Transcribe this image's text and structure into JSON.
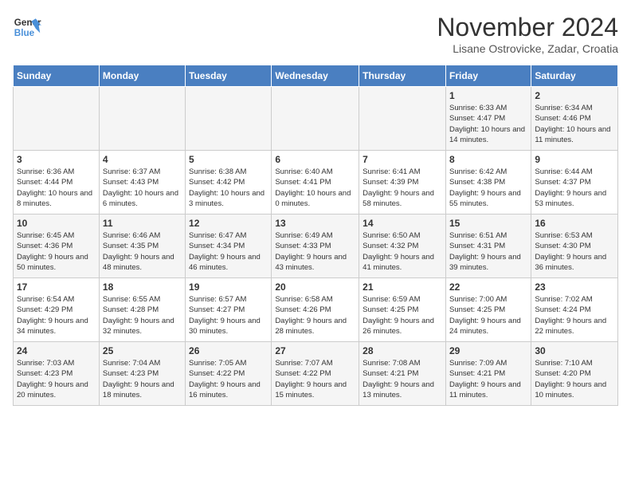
{
  "logo": {
    "line1": "General",
    "line2": "Blue"
  },
  "title": "November 2024",
  "subtitle": "Lisane Ostrovicke, Zadar, Croatia",
  "days_of_week": [
    "Sunday",
    "Monday",
    "Tuesday",
    "Wednesday",
    "Thursday",
    "Friday",
    "Saturday"
  ],
  "weeks": [
    [
      {
        "day": "",
        "info": ""
      },
      {
        "day": "",
        "info": ""
      },
      {
        "day": "",
        "info": ""
      },
      {
        "day": "",
        "info": ""
      },
      {
        "day": "",
        "info": ""
      },
      {
        "day": "1",
        "info": "Sunrise: 6:33 AM\nSunset: 4:47 PM\nDaylight: 10 hours and 14 minutes."
      },
      {
        "day": "2",
        "info": "Sunrise: 6:34 AM\nSunset: 4:46 PM\nDaylight: 10 hours and 11 minutes."
      }
    ],
    [
      {
        "day": "3",
        "info": "Sunrise: 6:36 AM\nSunset: 4:44 PM\nDaylight: 10 hours and 8 minutes."
      },
      {
        "day": "4",
        "info": "Sunrise: 6:37 AM\nSunset: 4:43 PM\nDaylight: 10 hours and 6 minutes."
      },
      {
        "day": "5",
        "info": "Sunrise: 6:38 AM\nSunset: 4:42 PM\nDaylight: 10 hours and 3 minutes."
      },
      {
        "day": "6",
        "info": "Sunrise: 6:40 AM\nSunset: 4:41 PM\nDaylight: 10 hours and 0 minutes."
      },
      {
        "day": "7",
        "info": "Sunrise: 6:41 AM\nSunset: 4:39 PM\nDaylight: 9 hours and 58 minutes."
      },
      {
        "day": "8",
        "info": "Sunrise: 6:42 AM\nSunset: 4:38 PM\nDaylight: 9 hours and 55 minutes."
      },
      {
        "day": "9",
        "info": "Sunrise: 6:44 AM\nSunset: 4:37 PM\nDaylight: 9 hours and 53 minutes."
      }
    ],
    [
      {
        "day": "10",
        "info": "Sunrise: 6:45 AM\nSunset: 4:36 PM\nDaylight: 9 hours and 50 minutes."
      },
      {
        "day": "11",
        "info": "Sunrise: 6:46 AM\nSunset: 4:35 PM\nDaylight: 9 hours and 48 minutes."
      },
      {
        "day": "12",
        "info": "Sunrise: 6:47 AM\nSunset: 4:34 PM\nDaylight: 9 hours and 46 minutes."
      },
      {
        "day": "13",
        "info": "Sunrise: 6:49 AM\nSunset: 4:33 PM\nDaylight: 9 hours and 43 minutes."
      },
      {
        "day": "14",
        "info": "Sunrise: 6:50 AM\nSunset: 4:32 PM\nDaylight: 9 hours and 41 minutes."
      },
      {
        "day": "15",
        "info": "Sunrise: 6:51 AM\nSunset: 4:31 PM\nDaylight: 9 hours and 39 minutes."
      },
      {
        "day": "16",
        "info": "Sunrise: 6:53 AM\nSunset: 4:30 PM\nDaylight: 9 hours and 36 minutes."
      }
    ],
    [
      {
        "day": "17",
        "info": "Sunrise: 6:54 AM\nSunset: 4:29 PM\nDaylight: 9 hours and 34 minutes."
      },
      {
        "day": "18",
        "info": "Sunrise: 6:55 AM\nSunset: 4:28 PM\nDaylight: 9 hours and 32 minutes."
      },
      {
        "day": "19",
        "info": "Sunrise: 6:57 AM\nSunset: 4:27 PM\nDaylight: 9 hours and 30 minutes."
      },
      {
        "day": "20",
        "info": "Sunrise: 6:58 AM\nSunset: 4:26 PM\nDaylight: 9 hours and 28 minutes."
      },
      {
        "day": "21",
        "info": "Sunrise: 6:59 AM\nSunset: 4:25 PM\nDaylight: 9 hours and 26 minutes."
      },
      {
        "day": "22",
        "info": "Sunrise: 7:00 AM\nSunset: 4:25 PM\nDaylight: 9 hours and 24 minutes."
      },
      {
        "day": "23",
        "info": "Sunrise: 7:02 AM\nSunset: 4:24 PM\nDaylight: 9 hours and 22 minutes."
      }
    ],
    [
      {
        "day": "24",
        "info": "Sunrise: 7:03 AM\nSunset: 4:23 PM\nDaylight: 9 hours and 20 minutes."
      },
      {
        "day": "25",
        "info": "Sunrise: 7:04 AM\nSunset: 4:23 PM\nDaylight: 9 hours and 18 minutes."
      },
      {
        "day": "26",
        "info": "Sunrise: 7:05 AM\nSunset: 4:22 PM\nDaylight: 9 hours and 16 minutes."
      },
      {
        "day": "27",
        "info": "Sunrise: 7:07 AM\nSunset: 4:22 PM\nDaylight: 9 hours and 15 minutes."
      },
      {
        "day": "28",
        "info": "Sunrise: 7:08 AM\nSunset: 4:21 PM\nDaylight: 9 hours and 13 minutes."
      },
      {
        "day": "29",
        "info": "Sunrise: 7:09 AM\nSunset: 4:21 PM\nDaylight: 9 hours and 11 minutes."
      },
      {
        "day": "30",
        "info": "Sunrise: 7:10 AM\nSunset: 4:20 PM\nDaylight: 9 hours and 10 minutes."
      }
    ]
  ]
}
